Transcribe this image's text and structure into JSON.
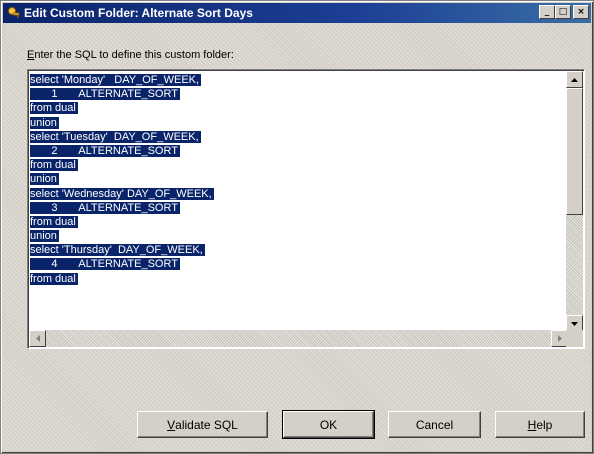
{
  "window": {
    "title": "Edit Custom Folder:  Alternate Sort Days",
    "minimize_symbol": "_",
    "maximize_symbol": "□",
    "close_symbol": "×"
  },
  "prompt": {
    "accel": "E",
    "rest": "nter the SQL to define this custom folder:"
  },
  "sql_lines": [
    {
      "text": "select 'Monday'   DAY_OF_WEEK,"
    },
    {
      "text": "       1       ALTERNATE_SORT"
    },
    {
      "text": "from dual"
    },
    {
      "text": "union"
    },
    {
      "text": "select 'Tuesday'  DAY_OF_WEEK,"
    },
    {
      "text": "       2       ALTERNATE_SORT"
    },
    {
      "text": "from dual"
    },
    {
      "text": "union"
    },
    {
      "text": "select 'Wednesday' DAY_OF_WEEK,"
    },
    {
      "text": "       3       ALTERNATE_SORT"
    },
    {
      "text": "from dual"
    },
    {
      "text": "union"
    },
    {
      "text": "select 'Thursday'  DAY_OF_WEEK,"
    },
    {
      "text": "       4       ALTERNATE_SORT"
    },
    {
      "text": "from dual"
    }
  ],
  "buttons": {
    "validate": {
      "accel": "V",
      "rest": "alidate SQL"
    },
    "ok": {
      "label": "OK"
    },
    "cancel": {
      "label": "Cancel"
    },
    "help": {
      "accel": "H",
      "rest": "elp"
    }
  },
  "colors": {
    "selection": "#0a246a",
    "titlebar": "#0a246a",
    "face": "#d4d0c8"
  },
  "icons": {
    "title": "folder-key-icon",
    "scroll_up": "arrow-up-icon",
    "scroll_down": "arrow-down-icon",
    "scroll_left": "arrow-left-icon",
    "scroll_right": "arrow-right-icon"
  }
}
